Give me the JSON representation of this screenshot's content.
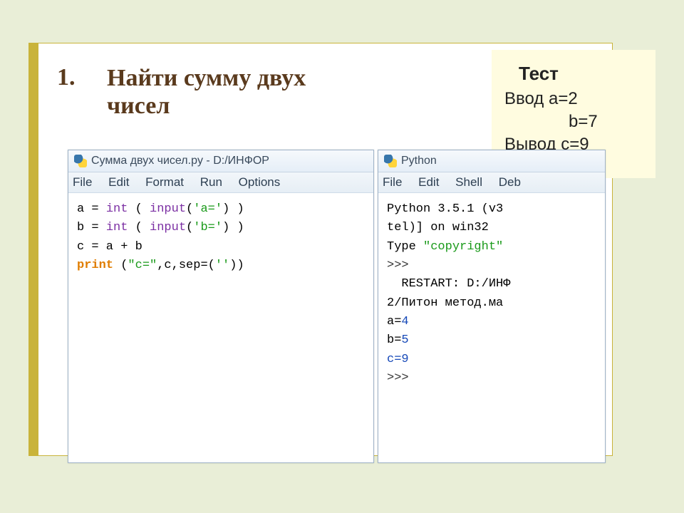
{
  "header": {
    "num": "1.",
    "title_line1": "Найти сумму двух",
    "title_line2": "чисел"
  },
  "testbox": {
    "title": "Тест",
    "in_label": "Ввод a=2",
    "in_b": "b=7",
    "out": "Вывод c=9"
  },
  "editor": {
    "title": "Сумма двух чисел.py - D:/ИНФОР",
    "menu": [
      "File",
      "Edit",
      "Format",
      "Run",
      "Options"
    ],
    "code": {
      "l1a": "a = ",
      "l1b": "int",
      "l1c": " ( ",
      "l1d": "input",
      "l1e": "(",
      "l1f": "'a='",
      "l1g": ") )",
      "l2a": "b = ",
      "l2b": "int",
      "l2c": " ( ",
      "l2d": "input",
      "l2e": "(",
      "l2f": "'b='",
      "l2g": ") )",
      "l3": "c = a + b",
      "l4a": "print",
      "l4b": " (",
      "l4c": "\"c=\"",
      "l4d": ",c,sep=(",
      "l4e": "''",
      "l4f": "))"
    }
  },
  "shell": {
    "title": "Python",
    "menu": [
      "File",
      "Edit",
      "Shell",
      "Deb"
    ],
    "out": {
      "l1": "Python 3.5.1 (v3",
      "l2": "tel)] on win32",
      "l3a": "Type ",
      "l3b": "\"copyright\"",
      "p1": ">>>",
      "r1": "  RESTART: D:/ИНФ",
      "r2": "2/Питон метод.ма",
      "a": "a=",
      "a_v": "4",
      "b": "b=",
      "b_v": "5",
      "c": "c=",
      "c_v": "9",
      "p2": ">>>"
    }
  }
}
